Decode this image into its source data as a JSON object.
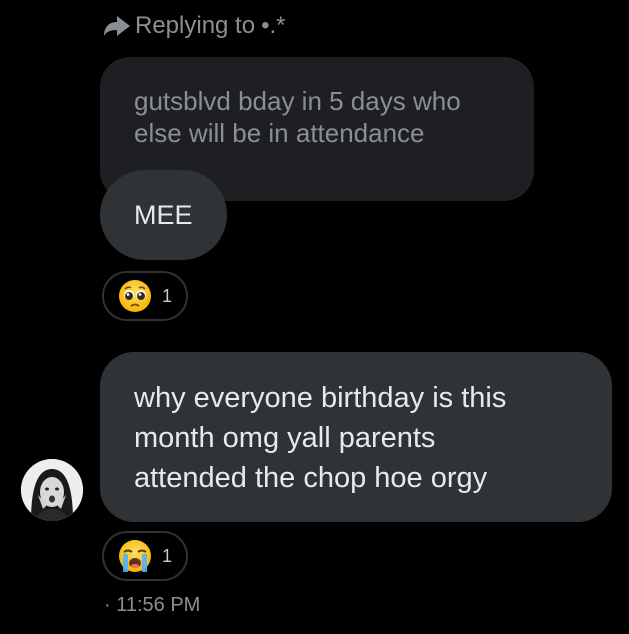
{
  "reply_header": {
    "label": "Replying to",
    "target": "•.*",
    "icon": "reply-arrow-icon"
  },
  "quoted_message": {
    "text_line1": "gutsblvd bday in 5 days who",
    "text_line2": "else will be in attendance"
  },
  "reply_message": {
    "text": "MEE",
    "reaction": {
      "emoji": "pleading-face-icon",
      "count": "1"
    }
  },
  "main_message": {
    "line1": "why everyone birthday is this",
    "line2": "month omg yall parents",
    "line3": "attended the chop hoe orgy",
    "reaction": {
      "emoji": "loudly-crying-face-icon",
      "count": "1"
    }
  },
  "sender": {
    "avatar": "avatar"
  },
  "timestamp": {
    "text": "· 11:56 PM"
  },
  "colors": {
    "background": "#000000",
    "bubble": "#2f3336",
    "quoted_bubble": "#1d1f22",
    "text_primary": "#e7e9ea",
    "text_secondary": "#8b8f94"
  }
}
